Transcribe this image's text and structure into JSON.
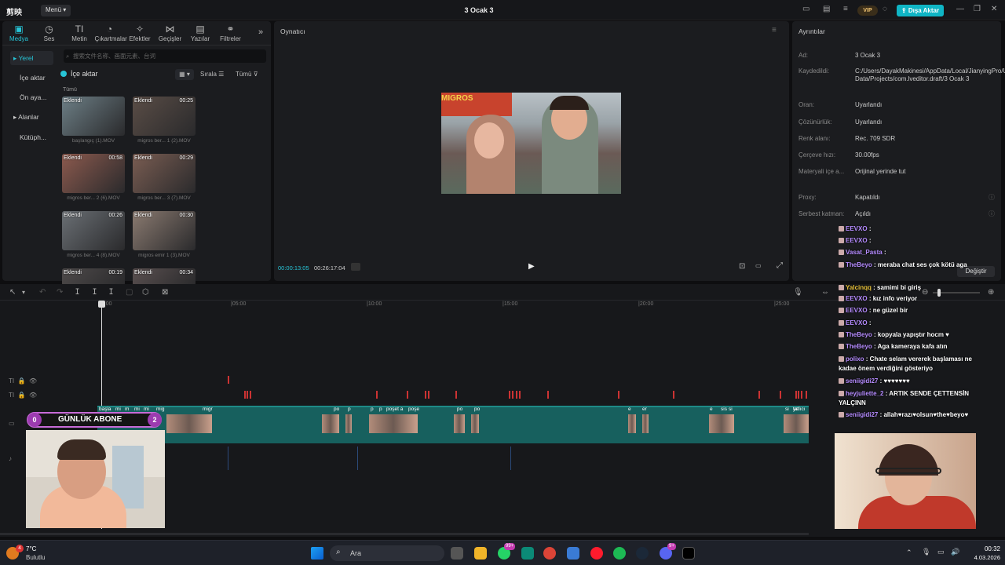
{
  "titlebar": {
    "logo": "剪映",
    "menu": "Menü",
    "project_title": "3 Ocak 3",
    "vip": "VIP",
    "export": "Dışa Aktar"
  },
  "tools": [
    {
      "label": "Medya",
      "icon": "media-icon",
      "glyph": "▣"
    },
    {
      "label": "Ses",
      "icon": "audio-icon",
      "glyph": "◷"
    },
    {
      "label": "Metin",
      "icon": "text-icon",
      "glyph": "TI"
    },
    {
      "label": "Çıkartmalar",
      "icon": "sticker-icon",
      "glyph": "◔"
    },
    {
      "label": "Efektler",
      "icon": "effects-icon",
      "glyph": "✧"
    },
    {
      "label": "Geçişler",
      "icon": "transitions-icon",
      "glyph": "⋈"
    },
    {
      "label": "Yazılar",
      "icon": "captions-icon",
      "glyph": "▤"
    },
    {
      "label": "Filtreler",
      "icon": "filters-icon",
      "glyph": "⚭"
    }
  ],
  "side_nav": [
    "Yerel",
    "İçe aktar",
    "Ön aya...",
    "Alanlar",
    "Kütüph..."
  ],
  "search": {
    "placeholder": "搜索文件名称、画面元素、台词"
  },
  "import_label": "İçe aktar",
  "sort_label": "Sırala",
  "filter_label": "Tümü",
  "group_label": "Tümü",
  "media_items": [
    {
      "tag": "Eklendi",
      "duration": "",
      "name": "başlangıç (1).MOV"
    },
    {
      "tag": "Eklendi",
      "duration": "00:25",
      "name": "migros ber... 1 (2).MOV"
    },
    {
      "tag": "Eklendi",
      "duration": "00:58",
      "name": "migros ber... 2 (6).MOV"
    },
    {
      "tag": "Eklendi",
      "duration": "00:29",
      "name": "migros ber... 3 (7).MOV"
    },
    {
      "tag": "Eklendi",
      "duration": "00:26",
      "name": "migros ber... 4 (8).MOV"
    },
    {
      "tag": "Eklendi",
      "duration": "00:30",
      "name": "migros emir 1 (3).MOV"
    },
    {
      "tag": "Eklendi",
      "duration": "00:19",
      "name": ""
    },
    {
      "tag": "Eklendi",
      "duration": "00:34",
      "name": ""
    }
  ],
  "player": {
    "title": "Oynatıcı",
    "current_time": "00:00:13:05",
    "total_time": "00:26:17:04"
  },
  "details": {
    "title": "Ayrıntılar",
    "rows": [
      {
        "label": "Ad:",
        "value": "3 Ocak 3"
      },
      {
        "label": "Kaydedildi:",
        "value": "C:/Users/DayakMakinesi/AppData/Local/JianyingPro/User Data/Projects/com.lveditor.draft/3 Ocak 3"
      },
      {
        "label": "Oran:",
        "value": "Uyarlandı"
      },
      {
        "label": "Çözünürlük:",
        "value": "Uyarlandı"
      },
      {
        "label": "Renk alanı:",
        "value": "Rec. 709 SDR"
      },
      {
        "label": "Çerçeve hızı:",
        "value": "30.00fps"
      },
      {
        "label": "Materyali içe a...",
        "value": "Orijinal yerinde tut"
      },
      {
        "label": "Proxy:",
        "value": "Kapatıldı"
      },
      {
        "label": "Serbest katman:",
        "value": "Açıldı"
      }
    ],
    "change_button": "Değiştir"
  },
  "ruler": [
    "00:00",
    "|05:00",
    "|10:00",
    "|15:00",
    "|20:00",
    "|25:00"
  ],
  "overlay": {
    "left_num": "0",
    "text": "GÜNLÜK ABONE",
    "right_num": "2"
  },
  "clip_labels": [
    "başla",
    "mi",
    "m",
    "mi",
    "mi",
    "mig",
    "migr",
    "po",
    "p",
    "p",
    "p",
    "poşet a",
    "poşe",
    "po",
    "po",
    "e",
    "er",
    "e",
    "sis",
    "si",
    "si",
    "ye",
    "tatlıcı"
  ],
  "chat": [
    {
      "user": "EEVXO",
      "msg": ":",
      "color": "#b58bff"
    },
    {
      "user": "EEVXO",
      "msg": ":",
      "color": "#b58bff"
    },
    {
      "user": "Vasat_Pasta",
      "msg": ":",
      "color": "#b58bff"
    },
    {
      "user": "TheBeyo",
      "msg": ": meraba chat ses çok kötü aga",
      "color": "#b58bff"
    },
    {
      "user": "Yalcinqq",
      "msg": ": samimi bi giriş",
      "color": "#e8c23a"
    },
    {
      "user": "EEVXO",
      "msg": ": kız info veriyor",
      "color": "#b58bff"
    },
    {
      "user": "EEVXO",
      "msg": ": ne güzel bir",
      "color": "#b58bff"
    },
    {
      "user": "EEVXO",
      "msg": ":",
      "color": "#b58bff"
    },
    {
      "user": "TheBeyo",
      "msg": ": kopyala yapıştır hocm ♥",
      "color": "#b58bff"
    },
    {
      "user": "TheBeyo",
      "msg": ": Aga kameraya kafa atın",
      "color": "#b58bff"
    },
    {
      "user": "polixo",
      "msg": ": Chate selam vererek başlaması ne kadae önem verdiğini gösteriyo",
      "color": "#b58bff"
    },
    {
      "user": "seniigidi27",
      "msg": ": ♥♥♥♥♥♥♥",
      "color": "#b58bff"
    },
    {
      "user": "heyjuliette_2",
      "msg": ": ARTIK SENDE ÇETTENSİN YALÇINN",
      "color": "#b58bff"
    },
    {
      "user": "seniigidi27",
      "msg": ": allah♥razı♥olsun♥the♥beyo♥",
      "color": "#b58bff"
    }
  ],
  "taskbar": {
    "weather_temp": "7°C",
    "weather_desc": "Bulutlu",
    "weather_badge": "4",
    "search": "Ara",
    "whatsapp_badge": "99+",
    "discord_badge": "9+",
    "time": "00:32",
    "date": "4.03.2026"
  },
  "colors": {
    "accent": "#27c4d6",
    "export": "#0fb5c5",
    "clip": "#17605e",
    "marker": "#cc3333"
  }
}
